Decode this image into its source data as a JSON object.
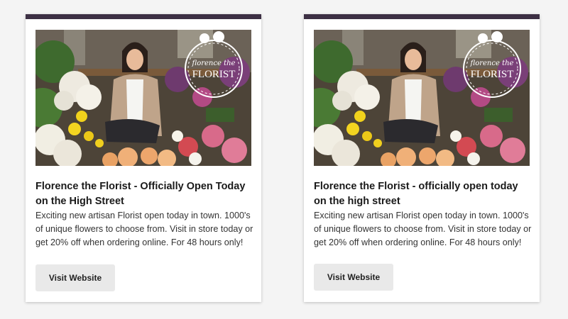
{
  "cards": [
    {
      "title": "Florence the Florist - Officially Open Today on the High Street",
      "description": "Exciting new artisan Florist open today in town. 1000's of unique flowers to choose from. Visit in store today or get 20% off when ordering online. For 48 hours only!",
      "button_label": "Visit Website",
      "logo_script": "florence the",
      "logo_caps": "FLORIST"
    },
    {
      "title": "Florence the Florist - officially open today on the high street",
      "description": "Exciting new artisan Florist open today in town. 1000's of unique flowers to choose from. Visit in store today or get 20% off when ordering online. For 48 hours only!",
      "button_label": "Visit Website",
      "logo_script": "florence the",
      "logo_caps": "FLORIST"
    }
  ],
  "colors": {
    "accent_bar": "#3d3044",
    "button_bg": "#e9e9e9",
    "page_bg": "#f4f4f4"
  }
}
